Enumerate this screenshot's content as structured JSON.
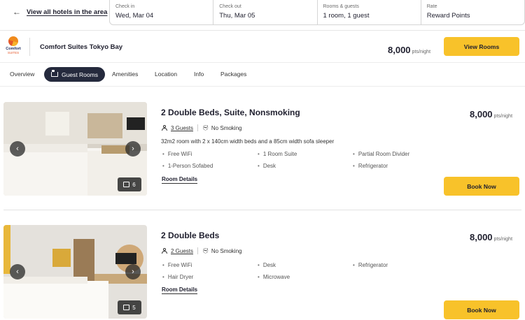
{
  "topbar": {
    "back_label": "View all hotels in the area",
    "fields": [
      {
        "label": "Check in",
        "value": "Wed, Mar 04"
      },
      {
        "label": "Check out",
        "value": "Thu, Mar 05"
      },
      {
        "label": "Rooms & guests",
        "value": "1 room, 1 guest"
      },
      {
        "label": "Rate",
        "value": "Reward Points"
      }
    ]
  },
  "hotel": {
    "logo_line1": "Comfort",
    "logo_line2": "SUITES",
    "name": "Comfort Suites Tokyo Bay",
    "price": "8,000",
    "price_unit": "pts/night",
    "view_rooms_label": "View Rooms"
  },
  "tabs": [
    "Overview",
    "Guest Rooms",
    "Amenities",
    "Location",
    "Info",
    "Packages"
  ],
  "active_tab": "Guest Rooms",
  "rooms": [
    {
      "title": "2 Double Beds, Suite, Nonsmoking",
      "guests": "3 Guests",
      "smoking": "No Smoking",
      "description": "32m2 room with 2 x 140cm width beds and a 85cm width sofa sleeper",
      "amenities": [
        "Free WiFi",
        "1 Room Suite",
        "Partial Room Divider",
        "1-Person Sofabed",
        "Desk",
        "Refrigerator"
      ],
      "details_label": "Room Details",
      "photo_count": "6",
      "price": "8,000",
      "price_unit": "pts/night",
      "book_label": "Book Now"
    },
    {
      "title": "2 Double Beds",
      "guests": "2 Guests",
      "smoking": "No Smoking",
      "description": "",
      "amenities": [
        "Free WiFi",
        "Desk",
        "Refrigerator",
        "Hair Dryer",
        "Microwave"
      ],
      "details_label": "Room Details",
      "photo_count": "5",
      "price": "8,000",
      "price_unit": "pts/night",
      "book_label": "Book Now"
    }
  ],
  "colors": {
    "accent": "#f8c22a",
    "active_tab_bg": "#252a3d",
    "text": "#1f1f2e"
  }
}
